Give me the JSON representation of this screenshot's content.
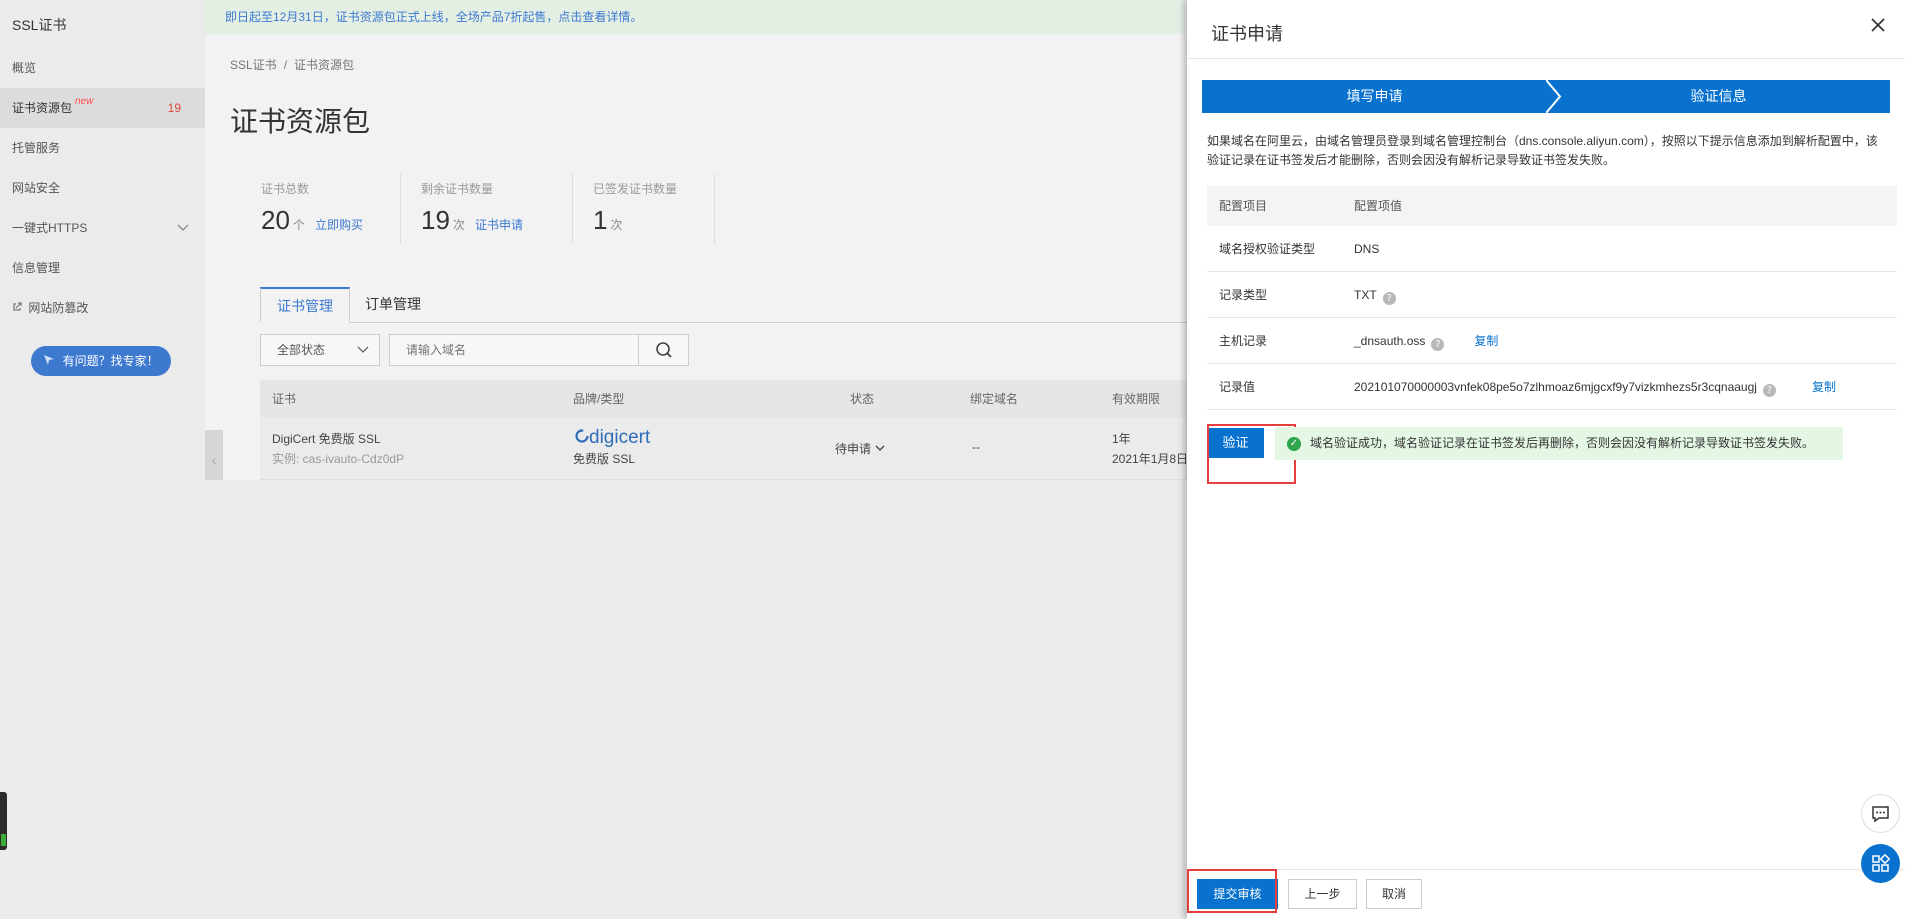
{
  "sidebar": {
    "title": "SSL证书",
    "items": [
      {
        "label": "概览"
      },
      {
        "label": "证书资源包",
        "badge": "new",
        "count": "19"
      },
      {
        "label": "托管服务"
      },
      {
        "label": "网站安全"
      },
      {
        "label": "一键式HTTPS"
      },
      {
        "label": "信息管理"
      },
      {
        "label": "网站防篡改"
      }
    ],
    "help_button": "有问题？找专家！"
  },
  "notice": "即日起至12月31日，证书资源包正式上线，全场产品7折起售，点击查看详情。",
  "breadcrumb": [
    "SSL证书",
    "证书资源包"
  ],
  "page_title": "证书资源包",
  "stats": [
    {
      "label": "证书总数",
      "value": "20",
      "unit": "个",
      "link": "立即购买"
    },
    {
      "label": "剩余证书数量",
      "value": "19",
      "unit": "次",
      "link": "证书申请"
    },
    {
      "label": "已签发证书数量",
      "value": "1",
      "unit": "次",
      "link": ""
    }
  ],
  "tabs": [
    "证书管理",
    "订单管理"
  ],
  "filter": {
    "status": "全部状态",
    "search_placeholder": "请输入域名"
  },
  "table": {
    "headers": [
      "证书",
      "品牌/类型",
      "状态",
      "绑定域名",
      "有效期限"
    ],
    "rows": [
      {
        "name": "DigiCert 免费版 SSL",
        "instance": "实例: cas-ivauto-Cdz0dP",
        "brand": "digicert",
        "brand_type": "免费版 SSL",
        "status": "待申请",
        "domain": "--",
        "validity": "1年",
        "validity_date": "2021年1月8日"
      }
    ]
  },
  "drawer": {
    "title": "证书申请",
    "steps": [
      "填写申请",
      "验证信息"
    ],
    "instructions": "如果域名在阿里云，由域名管理员登录到域名管理控制台（dns.console.aliyun.com），按照以下提示信息添加到解析配置中，该验证记录在证书签发后才能删除，否则会因没有解析记录导致证书签发失败。",
    "config": {
      "headers": [
        "配置项目",
        "配置项值"
      ],
      "rows": [
        {
          "key": "域名授权验证类型",
          "value": "DNS",
          "help": false,
          "copy": ""
        },
        {
          "key": "记录类型",
          "value": "TXT",
          "help": true,
          "copy": ""
        },
        {
          "key": "主机记录",
          "value": "_dnsauth.oss",
          "help": true,
          "copy": "复制"
        },
        {
          "key": "记录值",
          "value": "202101070000003vnfek08pe5o7zlhmoaz6mjgcxf9y7vizkmhezs5r3cqnaaugj",
          "help": true,
          "copy": "复制"
        }
      ]
    },
    "verify_button": "验证",
    "success_message": "域名验证成功，域名验证记录在证书签发后再删除，否则会因没有解析记录导致证书签发失败。",
    "footer": {
      "submit": "提交审核",
      "prev": "上一步",
      "cancel": "取消"
    }
  }
}
